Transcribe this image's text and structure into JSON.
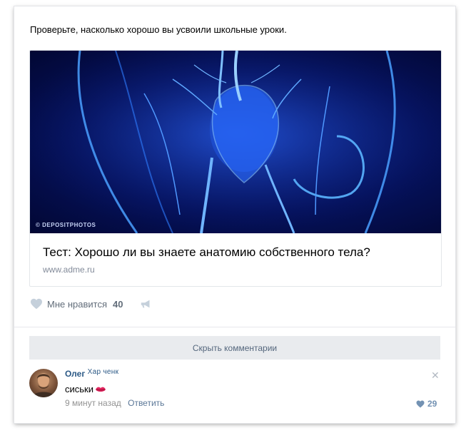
{
  "post": {
    "text": "Проверьте, насколько хорошо вы усвоили школьные уроки.",
    "attachment": {
      "watermark": "© DEPOSITPHOTOS",
      "title": "Тест: Хорошо ли вы знаете анатомию собственного тела?",
      "url": "www.adme.ru"
    },
    "actions": {
      "like_label": "Мне нравится",
      "like_count": "40",
      "heart_icon": "heart-icon",
      "share_icon": "megaphone-icon"
    }
  },
  "comments": {
    "hide_label": "Скрыть комментарии",
    "items": [
      {
        "author": "Олег",
        "author_tail": "Хар ченк",
        "text": "сиськи",
        "emoji": "lips-emoji",
        "time": "9 минут назад",
        "reply_label": "Ответить",
        "likes": "29",
        "close_icon": "close-icon"
      }
    ]
  },
  "colors": {
    "link": "#2a5885",
    "muted": "#828a99",
    "button_bg": "#e9ebee",
    "image_bg": "#05115a"
  }
}
